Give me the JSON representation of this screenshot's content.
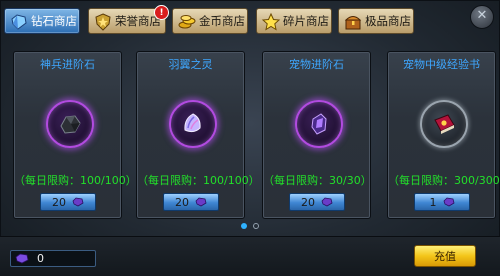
{
  "tabs": [
    {
      "label": "钻石商店",
      "icon": "diamond-icon",
      "active": true
    },
    {
      "label": "荣誉商店",
      "icon": "honor-shield-icon",
      "active": false,
      "badge": "!"
    },
    {
      "label": "金币商店",
      "icon": "gold-coins-icon",
      "active": false
    },
    {
      "label": "碎片商店",
      "icon": "star-fragment-icon",
      "active": false
    },
    {
      "label": "极品商店",
      "icon": "treasure-chest-icon",
      "active": false
    }
  ],
  "close_icon": "✕",
  "items": [
    {
      "name": "神兵进阶石",
      "limit": "（每日限购：100/100）",
      "price": "20",
      "icon": "weapon-stone-icon"
    },
    {
      "name": "羽翼之灵",
      "limit": "（每日限购：100/100）",
      "price": "20",
      "icon": "wing-spirit-icon"
    },
    {
      "name": "宠物进阶石",
      "limit": "（每日限购：30/30）",
      "price": "20",
      "icon": "pet-stone-icon"
    },
    {
      "name": "宠物中级经验书",
      "limit": "（每日限购：300/300）",
      "price": "1",
      "icon": "exp-book-icon"
    }
  ],
  "pager": {
    "current": 1,
    "total": 2
  },
  "footer": {
    "diamond_balance": "0",
    "recharge_label": "充值"
  },
  "colors": {
    "title_blue": "#3ea7ff",
    "limit_green": "#22e02a",
    "active_tab": "#2c6db3",
    "recharge_gold": "#f3c519"
  }
}
